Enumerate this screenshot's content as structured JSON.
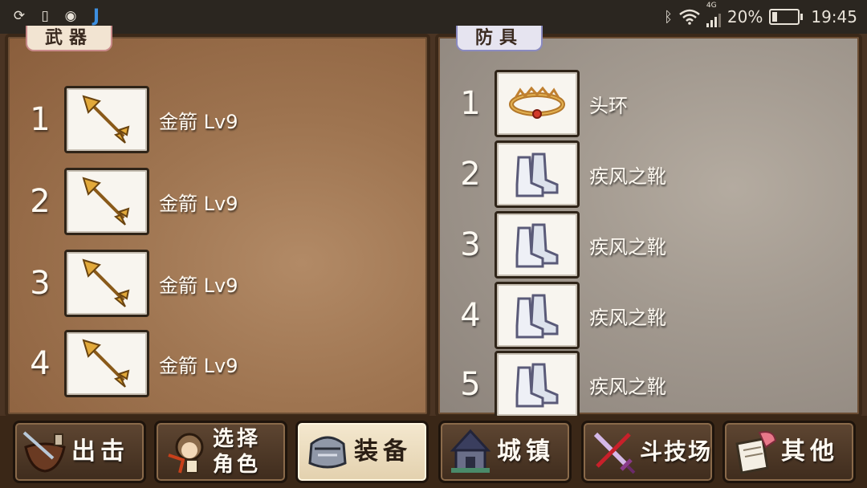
{
  "status_bar": {
    "battery": "20%",
    "battery_level": 0.2,
    "network": "4G",
    "time": "19:45",
    "left_icons": [
      "sync-icon",
      "sim-icon",
      "eye-icon",
      "j-app-icon"
    ]
  },
  "weapon_panel": {
    "tab_label": "武器",
    "items": [
      {
        "index": "1",
        "name": "金箭 Lv9",
        "icon": "gold-arrow-icon"
      },
      {
        "index": "2",
        "name": "金箭 Lv9",
        "icon": "gold-arrow-icon"
      },
      {
        "index": "3",
        "name": "金箭 Lv9",
        "icon": "gold-arrow-icon"
      },
      {
        "index": "4",
        "name": "金箭 Lv9",
        "icon": "gold-arrow-icon"
      }
    ]
  },
  "armor_panel": {
    "tab_label": "防具",
    "items": [
      {
        "index": "1",
        "name": "头环",
        "icon": "circlet-icon"
      },
      {
        "index": "2",
        "name": "疾风之靴",
        "icon": "boots-icon"
      },
      {
        "index": "3",
        "name": "疾风之靴",
        "icon": "boots-icon"
      },
      {
        "index": "4",
        "name": "疾风之靴",
        "icon": "boots-icon"
      },
      {
        "index": "5",
        "name": "疾风之靴",
        "icon": "boots-icon"
      }
    ]
  },
  "nav": [
    {
      "label": "出击",
      "icon": "sortie-icon",
      "active": false
    },
    {
      "label": "选择角色",
      "line1": "选择",
      "line2": "角色",
      "icon": "character-icon",
      "active": false
    },
    {
      "label": "装备",
      "icon": "equipment-icon",
      "active": true
    },
    {
      "label": "城镇",
      "icon": "town-icon",
      "active": false
    },
    {
      "label": "斗技场",
      "icon": "arena-icon",
      "active": false
    },
    {
      "label": "其他",
      "icon": "other-icon",
      "active": false
    }
  ]
}
